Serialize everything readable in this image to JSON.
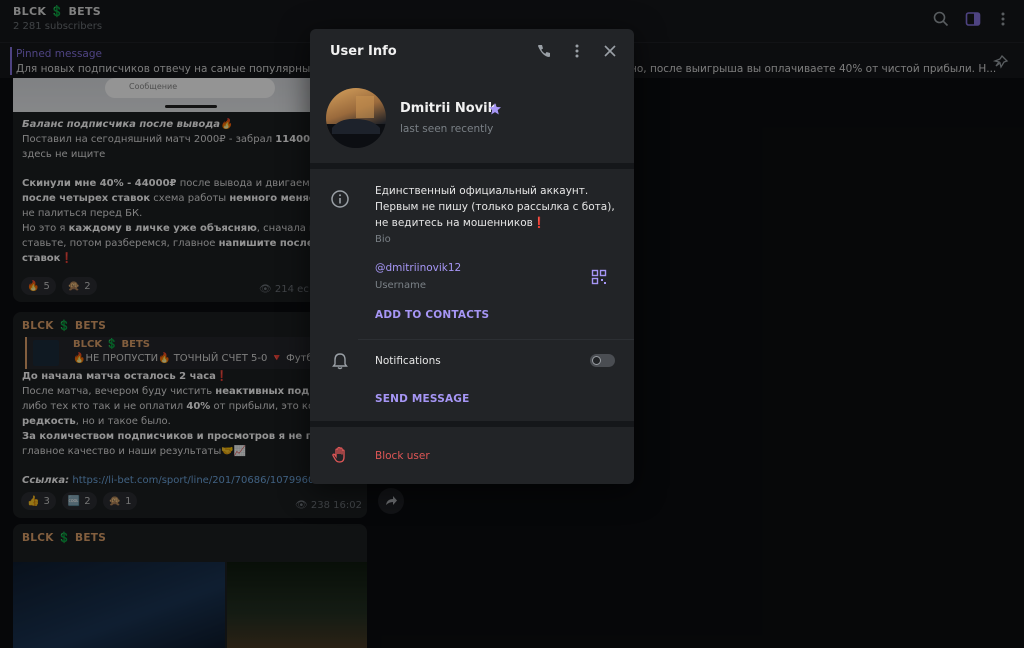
{
  "header": {
    "channel_title": "BLCK 💲 BETS",
    "subscribers": "2 281 subscribers"
  },
  "pinned": {
    "title": "Pinned message",
    "text_left": "Для новых подписчиков отвечу на самые популярные во",
    "text_right": "но, после выигрыша вы оплачиваете 40% от чистой прибыли. Н..."
  },
  "messages": {
    "m1": {
      "image_field_text": "Сообщение",
      "line1_italic": "Баланс подписчика после вывода🔥",
      "line2": "Поставил на сегодняшний матч 2000₽ - забрал ",
      "line2_bold": "114000.",
      "line2_tail": " П",
      "line3": "здесь не ищите",
      "line4_bold": "Скинули мне 40% - 44000₽",
      "line4_tail": " после вывода и двигаемся да",
      "line5_bold": "после четырех ставок",
      "line5_mid": " схема работы ",
      "line5_bold2": "немного меняется",
      "line6": "не палиться перед БК.",
      "line7": "Но это я ",
      "line7_bold": "каждому в личке уже объясняю",
      "line7_tail": ", сначала прост",
      "line8": "ставьте, потом разберемся, главное ",
      "line8_bold": "напишите после т",
      "line9_bold": "ставок",
      "line9_tail": "❗",
      "reactions": [
        {
          "emoji": "🔥",
          "count": "5"
        },
        {
          "emoji": "🙊",
          "count": "2"
        }
      ],
      "views": "214",
      "time_partial": "ес"
    },
    "m2": {
      "sender": "BLCK 💲 BETS",
      "fwd_name": "BLCK 💲 BETS",
      "fwd_text": "🔥НЕ ПРОПУСТИ🔥 ТОЧНЫЙ СЧЕТ 5-0 🔻 Футб",
      "line1_bold": "До начала матча осталось 2 часа",
      "line1_tail": "❗",
      "line2": "После матча, вечером буду чистить ",
      "line2_bold": "неактивных подпи",
      "line3": "либо тех кто так и не оплатил ",
      "line3_bold": "40%",
      "line3_tail": " от прибыли, это конеч",
      "line4_bold": "редкость",
      "line4_tail": ", но и такое было.",
      "line5_bold": "За количеством подписчиков и просмотров я не гоню",
      "line6": "главное качество и наши результаты🤝📈",
      "link_label": "Ссылка:",
      "link_url": "https://li-bet.com/sport/line/201/70686/10799601",
      "reactions": [
        {
          "emoji": "👍",
          "count": "3"
        },
        {
          "emoji": "🆒",
          "count": "2"
        },
        {
          "emoji": "🙊",
          "count": "1"
        }
      ],
      "views": "238",
      "time": "16:02"
    },
    "m3": {
      "sender": "BLCK 💲 BETS"
    }
  },
  "modal": {
    "title": "User Info",
    "name": "Dmitrii Novik",
    "last_seen": "last seen recently",
    "bio_line1": "Единственный официальный аккаунт.",
    "bio_line2": "Первым не пишу (только рассылка с бота),",
    "bio_line3": "не ведитесь на мошенников❗",
    "bio_label": "Bio",
    "username": "@dmitriinovik12",
    "username_label": "Username",
    "add_to_contacts": "ADD TO CONTACTS",
    "notifications": "Notifications",
    "notifications_on": false,
    "send_message": "SEND MESSAGE",
    "block_user": "Block user"
  },
  "colors": {
    "accent": "#8774e1",
    "danger": "#e05656",
    "channel_name": "#e0a36b"
  }
}
